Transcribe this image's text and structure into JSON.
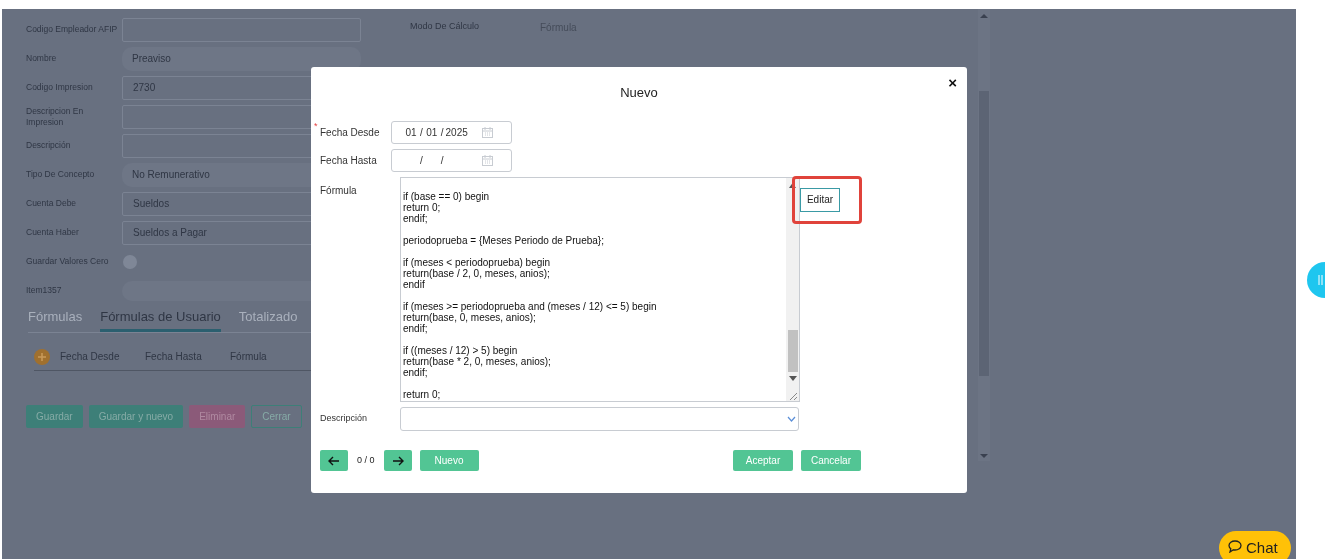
{
  "background_form": {
    "fields": [
      {
        "label": "Codigo Empleador AFIP",
        "kind": "input"
      },
      {
        "label": "Nombre",
        "kind": "readonly",
        "value": "Preaviso"
      },
      {
        "label": "Codigo Impresion",
        "kind": "input",
        "value": "2730"
      },
      {
        "label": "Descripcion En Impresion",
        "kind": "input"
      },
      {
        "label": "Descripción",
        "kind": "input"
      },
      {
        "label": "Tipo De Concepto",
        "kind": "readonly",
        "value": "No Remunerativo"
      },
      {
        "label": "Cuenta Debe",
        "kind": "input",
        "value": "Sueldos"
      },
      {
        "label": "Cuenta Haber",
        "kind": "input",
        "value": "Sueldos a Pagar"
      },
      {
        "label": "Guardar Valores Cero",
        "kind": "toggle",
        "on": false
      },
      {
        "label": "Item1357",
        "kind": "pill"
      }
    ],
    "side_field": {
      "label": "Modo De Cálculo",
      "value": "Fórmula"
    },
    "tabs": [
      {
        "label": "Fórmulas",
        "selected": false
      },
      {
        "label": "Fórmulas de Usuario",
        "selected": true
      },
      {
        "label": "Totalizado",
        "selected": false
      }
    ],
    "table": {
      "columns": [
        "Fecha Desde",
        "Fecha Hasta",
        "Fórmula"
      ]
    },
    "buttons": [
      {
        "label": "Guardar",
        "kind": "primary"
      },
      {
        "label": "Guardar y nuevo",
        "kind": "primary"
      },
      {
        "label": "Eliminar",
        "kind": "danger"
      },
      {
        "label": "Cerrar",
        "kind": "outline"
      }
    ]
  },
  "dialog": {
    "title": "Nuevo",
    "close": "×",
    "fecha_desde": {
      "label": "Fecha Desde",
      "required_mark": "*",
      "day": "01",
      "separators": [
        "/",
        "/"
      ],
      "month": "01",
      "year": "2025"
    },
    "fecha_hasta": {
      "label": "Fecha Hasta",
      "separators": [
        "/",
        "/"
      ]
    },
    "formula": {
      "label": "Fórmula",
      "value": "if (base == 0) begin\nreturn 0;\nendif;\n\nperiodoprueba = {Meses Periodo de Prueba};\n\nif (meses < periodoprueba) begin\nreturn(base / 2, 0, meses, anios);\nendif\n\nif (meses >= periodoprueba and (meses / 12) <= 5) begin\nreturn(base, 0, meses, anios);\nendif;\n\nif ((meses / 12) > 5) begin\nreturn(base * 2, 0, meses, anios);\nendif;\n\nreturn 0;"
    },
    "edit_button": {
      "label": "Editar",
      "highlighted": true
    },
    "descripcion": {
      "label": "Descripción"
    },
    "pager": "0 / 0",
    "new_button": "Nuevo",
    "accept_button": "Aceptar",
    "cancel_button": "Cancelar"
  },
  "chat_button": "Chat"
}
